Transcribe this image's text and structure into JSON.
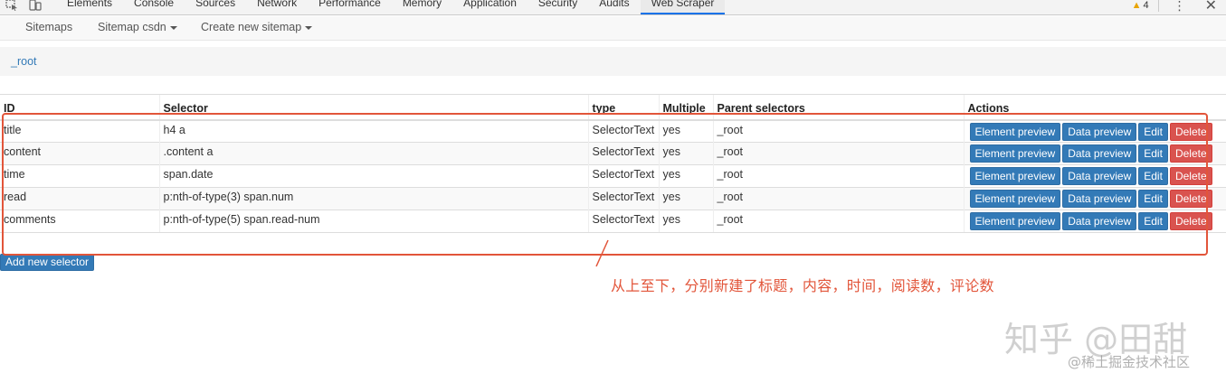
{
  "devtools": {
    "tabs": [
      "Elements",
      "Console",
      "Sources",
      "Network",
      "Performance",
      "Memory",
      "Application",
      "Security",
      "Audits",
      "Web Scraper"
    ],
    "active_tab": "Web Scraper",
    "warning_count": "4",
    "icons": [
      "inspect-icon",
      "device-toggle-icon",
      "warning-icon",
      "kebab-menu-icon",
      "close-icon"
    ],
    "accent_color": "#1a73e8"
  },
  "nav": {
    "sitemaps": "Sitemaps",
    "sitemap_csdn": "Sitemap csdn",
    "create_new": "Create new sitemap"
  },
  "breadcrumb": "_root",
  "table": {
    "headers": [
      "ID",
      "Selector",
      "type",
      "Multiple",
      "Parent selectors",
      "Actions"
    ],
    "rows": [
      {
        "id": "title",
        "selector": "h4 a",
        "type": "SelectorText",
        "multiple": "yes",
        "parent": "_root"
      },
      {
        "id": "content",
        "selector": ".content a",
        "type": "SelectorText",
        "multiple": "yes",
        "parent": "_root"
      },
      {
        "id": "time",
        "selector": "span.date",
        "type": "SelectorText",
        "multiple": "yes",
        "parent": "_root"
      },
      {
        "id": "read",
        "selector": "p:nth-of-type(3) span.num",
        "type": "SelectorText",
        "multiple": "yes",
        "parent": "_root"
      },
      {
        "id": "comments",
        "selector": "p:nth-of-type(5) span.read-num",
        "type": "SelectorText",
        "multiple": "yes",
        "parent": "_root"
      }
    ],
    "actions": {
      "element_preview": "Element preview",
      "data_preview": "Data preview",
      "edit": "Edit",
      "delete": "Delete"
    }
  },
  "add_selector": "Add new selector",
  "annotation": {
    "text": "从上至下，分别新建了标题，内容，时间，阅读数，评论数",
    "color": "#e2553a"
  },
  "watermarks": {
    "zhihu": "知乎 @田甜",
    "juejin": "@稀土掘金技术社区"
  },
  "colors": {
    "primary_button": "#337ab7",
    "danger_button": "#d9534f",
    "link": "#337ab7"
  }
}
